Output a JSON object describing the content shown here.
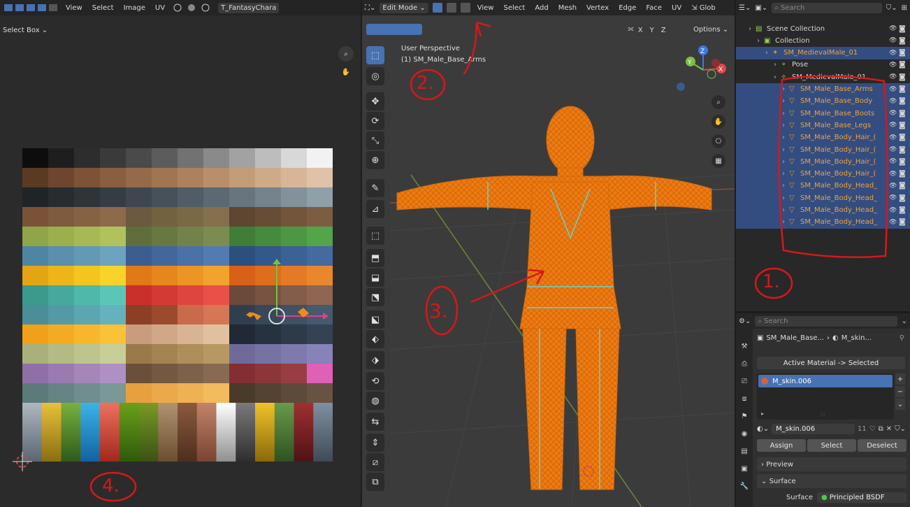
{
  "uv_editor": {
    "menu": [
      "View",
      "Select",
      "Image",
      "UV"
    ],
    "image_name": "T_FantasyChara",
    "select_mode": "Select Box",
    "palette_rows": [
      [
        "#0d0d0d",
        "#1e1e1e",
        "#2d2d2d",
        "#3a3a3a",
        "#4a4a4a",
        "#5c5c5c",
        "#727272",
        "#8a8a8a",
        "#a2a2a2",
        "#bdbdbd",
        "#d8d8d8",
        "#f2f2f2"
      ],
      [
        "#5b3a24",
        "#6e4630",
        "#7d5236",
        "#8a5e40",
        "#946a4a",
        "#a07552",
        "#ac825e",
        "#b88f6a",
        "#c39c78",
        "#cfaa88",
        "#d7b698",
        "#dfc2a8"
      ],
      [
        "#1f2428",
        "#262c31",
        "#2d343a",
        "#353d44",
        "#3e474f",
        "#47515a",
        "#515c66",
        "#5c6872",
        "#68757f",
        "#75838d",
        "#82919a",
        "#90a0a8"
      ],
      [
        "#7a5236",
        "#7f5a3c",
        "#866243",
        "#8c6a4a",
        "#6b5a3f",
        "#73613f",
        "#7b6845",
        "#84704c",
        "#5e4631",
        "#684d36",
        "#73553b",
        "#7d5d41"
      ],
      [
        "#8fa547",
        "#9bb04d",
        "#a6b954",
        "#b1c25b",
        "#5f6e3c",
        "#687843",
        "#72824a",
        "#7c8c51",
        "#3f7d38",
        "#468a3e",
        "#4d9744",
        "#54a44a"
      ],
      [
        "#4f84a3",
        "#5a8fad",
        "#6499b6",
        "#6ea3bf",
        "#3c5d8f",
        "#44679b",
        "#4c71a6",
        "#547bb1",
        "#2c4f7e",
        "#345889",
        "#3c6194",
        "#446a9f"
      ],
      [
        "#e4a512",
        "#edb519",
        "#f4c51f",
        "#f8d329",
        "#e07916",
        "#e6871d",
        "#ec9525",
        "#f2a32d",
        "#d86018",
        "#de6d1e",
        "#e47a25",
        "#ea872c"
      ],
      [
        "#3c9a8d",
        "#46a99b",
        "#50b8aa",
        "#5bc6b8",
        "#c9302b",
        "#d43a34",
        "#de453e",
        "#e85048",
        "#6c4a3a",
        "#785342",
        "#845c4a",
        "#906552"
      ],
      [
        "#4a8e9a",
        "#539aa6",
        "#5ca6b2",
        "#65b2be",
        "#8c3f26",
        "#9c4a2e",
        "#c96a4a",
        "#d57755",
        "#2f3f4f",
        "#374859",
        "#3f5163",
        "#475a6d"
      ],
      [
        "#f0a019",
        "#f4ab23",
        "#f8b62d",
        "#fbc137",
        "#c89c7c",
        "#d0a888",
        "#d9b494",
        "#e1c0a0",
        "#1f2a36",
        "#263240",
        "#2d3a4a",
        "#344254"
      ],
      [
        "#a9b07a",
        "#b4ba84",
        "#bec48e",
        "#c8ce98",
        "#9a7a4a",
        "#a48452",
        "#ae8e5a",
        "#b89862",
        "#6f6a9a",
        "#7772a4",
        "#7f7aae",
        "#8782b8"
      ],
      [
        "#8f6fa6",
        "#9a7ab0",
        "#a585ba",
        "#b090c4",
        "#6a4f3a",
        "#745842",
        "#7e614a",
        "#886a52",
        "#822e32",
        "#8d363a",
        "#983e42",
        "#e060b8"
      ],
      [
        "#5c7a78",
        "#668482",
        "#708e8c",
        "#7a9896",
        "#e6a040",
        "#eaa94a",
        "#eeb254",
        "#f2bb5e",
        "#4a3a2a",
        "#544232",
        "#5e4a3a",
        "#685242"
      ]
    ],
    "gradient_columns": [
      [
        "#aeb8c0",
        "#5a6670"
      ],
      [
        "#e8c23a",
        "#8a6e12"
      ],
      [
        "#7ab03e",
        "#2e5a1a"
      ],
      [
        "#3ab4e8",
        "#1262a0"
      ],
      [
        "#f07060",
        "#a0281c"
      ],
      [
        "#6aa01a",
        "#2e5a0a"
      ],
      [
        "#7a9a24",
        "#3a5212"
      ],
      [
        "#b09470",
        "#6a4e30"
      ],
      [
        "#8a5a3e",
        "#4e2e1e"
      ],
      [
        "#c0846a",
        "#7a4432"
      ],
      [
        "#ffffff",
        "#909090"
      ],
      [
        "#7a7a7a",
        "#2e2e2e"
      ],
      [
        "#f2c22a",
        "#8a6a0a"
      ],
      [
        "#6a9a4a",
        "#2e5222"
      ],
      [
        "#a03032",
        "#4e1216"
      ],
      [
        "#8090a0",
        "#3e4a56"
      ]
    ]
  },
  "viewport": {
    "mode": "Edit Mode",
    "menu": [
      "View",
      "Select",
      "Add",
      "Mesh",
      "Vertex",
      "Edge",
      "Face",
      "UV"
    ],
    "transform_orientation": "Glob",
    "axes": [
      "X",
      "Y",
      "Z"
    ],
    "options_label": "Options",
    "perspective": "User Perspective",
    "object_info": "(1) SM_Male_Base_Arms",
    "gizmo_axes": [
      "Z",
      "Y",
      "X"
    ]
  },
  "outliner": {
    "search_placeholder": "Search",
    "rows": [
      {
        "label": "Scene Collection",
        "indent": 0,
        "selected": false,
        "orange": false,
        "icon": "scene-collection-icon"
      },
      {
        "label": "Collection",
        "indent": 1,
        "selected": false,
        "orange": false,
        "icon": "collection-icon"
      },
      {
        "label": "SM_MedievalMale_01",
        "indent": 2,
        "selected": true,
        "orange": true,
        "icon": "armature-icon"
      },
      {
        "label": "Pose",
        "indent": 3,
        "selected": false,
        "orange": false,
        "icon": "pose-icon"
      },
      {
        "label": "SM_MedievalMale_01",
        "indent": 3,
        "selected": false,
        "orange": false,
        "icon": "armature-data-icon"
      },
      {
        "label": "SM_Male_Base_Arms",
        "indent": 4,
        "selected": true,
        "orange": true,
        "icon": "mesh-icon"
      },
      {
        "label": "SM_Male_Base_Body",
        "indent": 4,
        "selected": true,
        "orange": true,
        "icon": "mesh-icon"
      },
      {
        "label": "SM_Male_Base_Boots",
        "indent": 4,
        "selected": true,
        "orange": true,
        "icon": "mesh-icon"
      },
      {
        "label": "SM_Male_Base_Legs",
        "indent": 4,
        "selected": true,
        "orange": true,
        "icon": "mesh-icon"
      },
      {
        "label": "SM_Male_Body_Hair_(",
        "indent": 4,
        "selected": true,
        "orange": true,
        "icon": "mesh-icon"
      },
      {
        "label": "SM_Male_Body_Hair_(",
        "indent": 4,
        "selected": true,
        "orange": true,
        "icon": "mesh-icon"
      },
      {
        "label": "SM_Male_Body_Hair_(",
        "indent": 4,
        "selected": true,
        "orange": true,
        "icon": "mesh-icon"
      },
      {
        "label": "SM_Male_Body_Hair_(",
        "indent": 4,
        "selected": true,
        "orange": true,
        "icon": "mesh-icon"
      },
      {
        "label": "SM_Male_Body_Head_",
        "indent": 4,
        "selected": true,
        "orange": true,
        "icon": "mesh-icon"
      },
      {
        "label": "SM_Male_Body_Head_",
        "indent": 4,
        "selected": true,
        "orange": true,
        "icon": "mesh-icon"
      },
      {
        "label": "SM_Male_Body_Head_",
        "indent": 4,
        "selected": true,
        "orange": true,
        "icon": "mesh-icon"
      },
      {
        "label": "SM_Male_Body_Head_",
        "indent": 4,
        "selected": true,
        "orange": true,
        "icon": "mesh-icon"
      }
    ]
  },
  "properties": {
    "search_placeholder": "Search",
    "breadcrumb_object": "SM_Male_Base...",
    "breadcrumb_material": "M_skin...",
    "material_link": "Active Material -> Selected",
    "slot_name": "M_skin.006",
    "material_name": "M_skin.006",
    "user_count": "11",
    "assign_label": "Assign",
    "select_label": "Select",
    "deselect_label": "Deselect",
    "preview_label": "Preview",
    "surface_label": "Surface",
    "surface_field_label": "Surface",
    "surface_shader": "Principled BSDF"
  },
  "annotations": [
    "1.",
    "2.",
    "3.",
    "4."
  ],
  "colors": {
    "accent": "#4772b3",
    "selection": "#f08a1e",
    "annotation": "#d6181a",
    "seam": "#5ad6d6"
  }
}
